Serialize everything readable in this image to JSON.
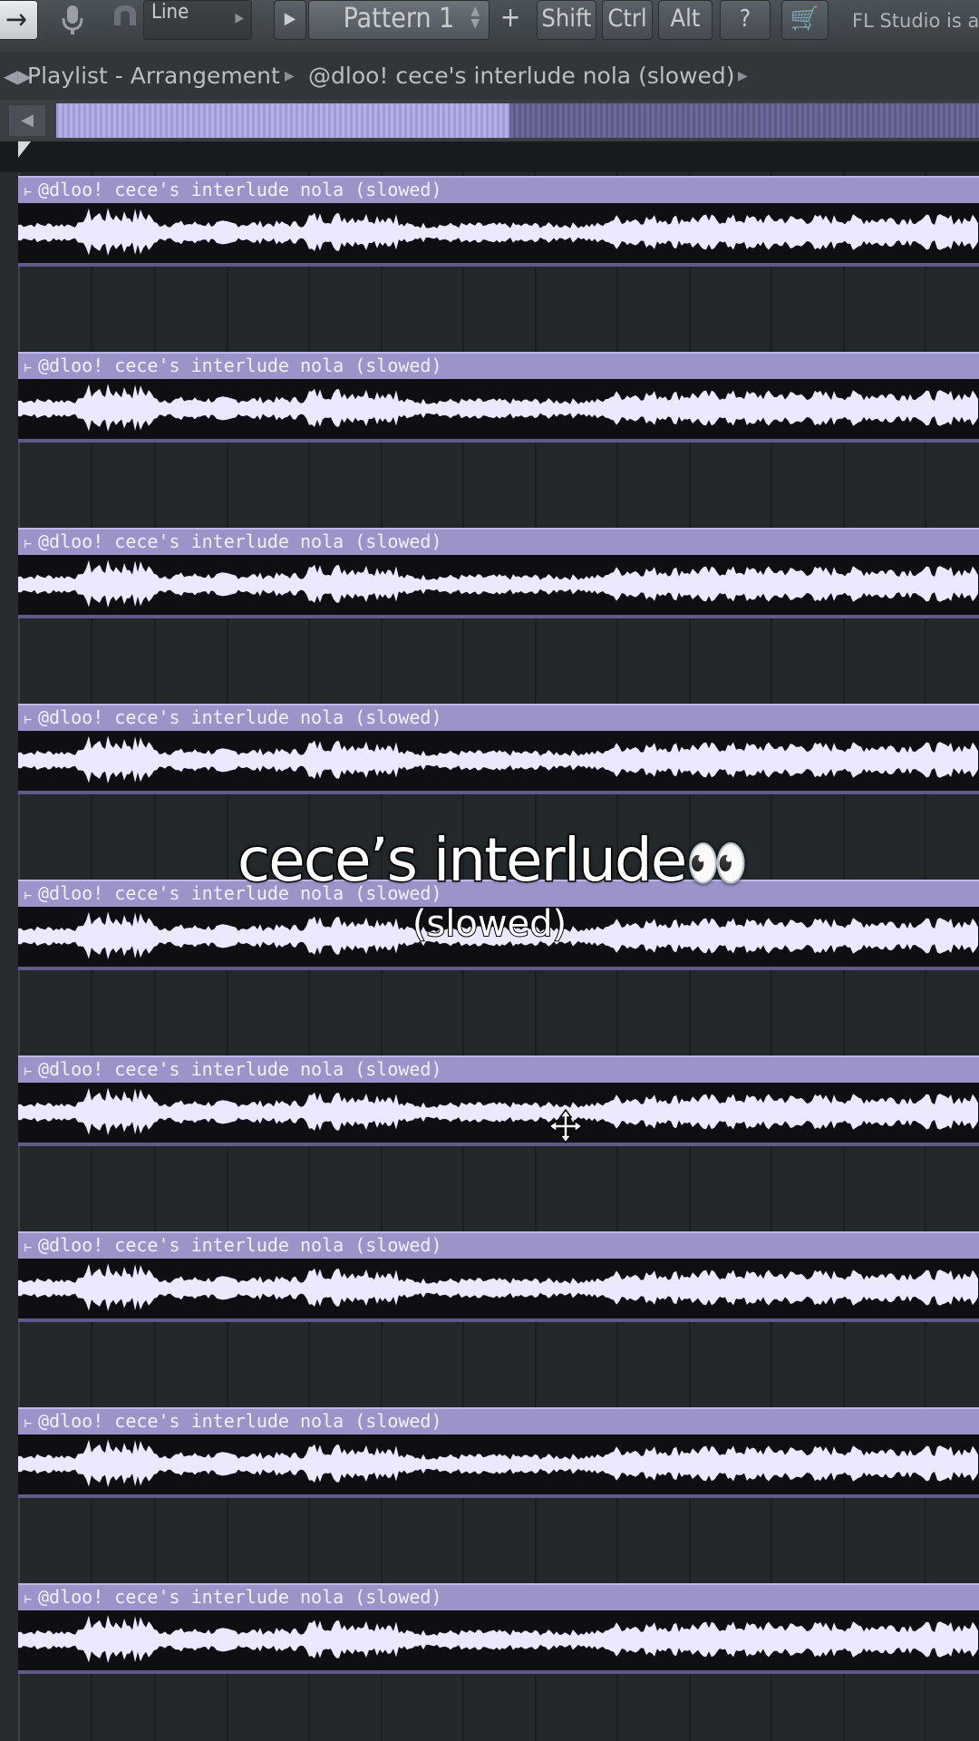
{
  "toolbar": {
    "arrow": "→",
    "mic_icon": "microphone-icon",
    "magnet_icon": "magnet-icon",
    "snap_label": "Line",
    "play_icon": "▶",
    "pattern_label": "Pattern 1",
    "plus": "+",
    "shift": "Shift",
    "ctrl": "Ctrl",
    "alt": "Alt",
    "help": "?",
    "cart": "🛒",
    "news": "FL Studio is av"
  },
  "titlebar": {
    "playlist": "Playlist - Arrangement",
    "pattern": "@dloo! cece's interlude nola (slowed)"
  },
  "clips": [
    {
      "label": "@dloo! cece's interlude nola (slowed)"
    },
    {
      "label": "@dloo! cece's interlude nola (slowed)"
    },
    {
      "label": "@dloo! cece's interlude nola (slowed)"
    },
    {
      "label": "@dloo! cece's interlude nola (slowed)"
    },
    {
      "label": "@dloo! cece's interlude nola (slowed)"
    },
    {
      "label": "@dloo! cece's interlude nola (slowed)"
    },
    {
      "label": "@dloo! cece's interlude nola (slowed)"
    },
    {
      "label": "@dloo! cece's interlude nola (slowed)"
    },
    {
      "label": "@dloo! cece's interlude nola (slowed)"
    }
  ],
  "overlay": {
    "title": "cece’s interlude",
    "eyes": "👀",
    "subtitle": "(slowed)"
  },
  "colors": {
    "clip_header": "#9b94c9",
    "waveform": "#ece8ff",
    "clip_body": "#0e0f12"
  }
}
